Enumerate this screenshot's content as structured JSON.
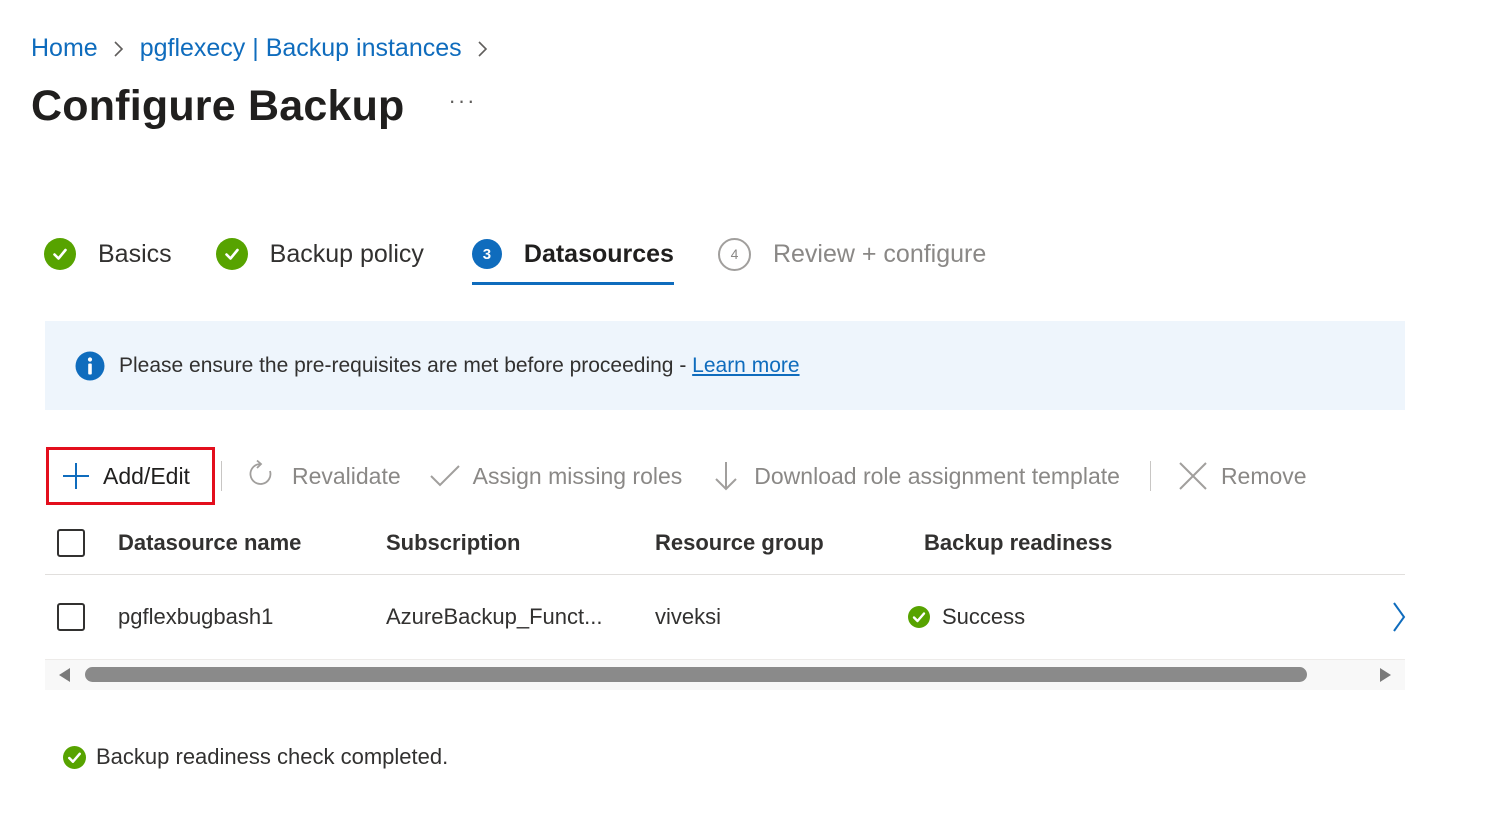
{
  "breadcrumb": {
    "items": [
      "Home",
      "pgflexecy | Backup instances"
    ]
  },
  "page": {
    "title": "Configure Backup",
    "more": "···"
  },
  "steps": [
    {
      "label": "Basics",
      "state": "done"
    },
    {
      "label": "Backup policy",
      "state": "done"
    },
    {
      "label": "Datasources",
      "state": "current",
      "number": "3"
    },
    {
      "label": "Review + configure",
      "state": "todo",
      "number": "4"
    }
  ],
  "info": {
    "message": "Please ensure the pre-requisites are met before proceeding - ",
    "link": "Learn more"
  },
  "toolbar": {
    "add_edit": "Add/Edit",
    "revalidate": "Revalidate",
    "assign_roles": "Assign missing roles",
    "download_template": "Download role assignment template",
    "remove": "Remove"
  },
  "table": {
    "columns": [
      "Datasource name",
      "Subscription",
      "Resource group",
      "Backup readiness"
    ],
    "rows": [
      {
        "datasource_name": "pgflexbugbash1",
        "subscription": "AzureBackup_Funct...",
        "resource_group": "viveksi",
        "backup_readiness": "Success"
      }
    ]
  },
  "status": {
    "message": "Backup readiness check completed."
  },
  "colors": {
    "accent": "#0f6cbd",
    "success": "#57a300",
    "highlight_border": "#e30e1d",
    "banner_bg": "#eef5fc"
  },
  "icons": [
    "chevron-right-icon",
    "check-circle-icon",
    "info-icon",
    "plus-icon",
    "refresh-icon",
    "checkmark-icon",
    "download-arrow-icon",
    "close-x-icon"
  ]
}
